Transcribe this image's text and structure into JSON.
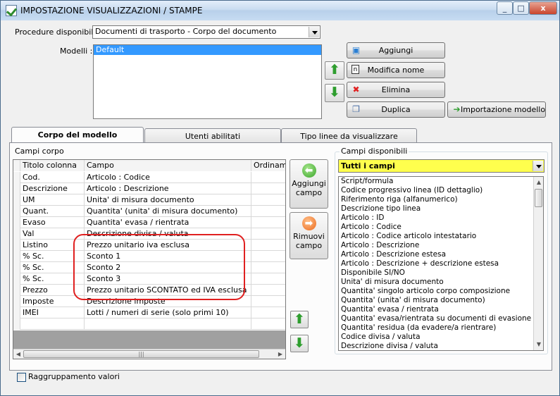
{
  "window": {
    "title": "IMPOSTAZIONE VISUALIZZAZIONI / STAMPE",
    "min_glyph": "_",
    "max_glyph": "□",
    "close_glyph": "x"
  },
  "top": {
    "procedure_label": "Procedure disponibili :",
    "procedure_value": "Documenti di trasporto - Corpo del documento",
    "models_label": "Modelli :",
    "models": [
      "Default"
    ],
    "buttons": {
      "add": "Aggiungi",
      "rename": "Modifica nome",
      "delete": "Elimina",
      "duplicate": "Duplica",
      "import": "Importazione modello"
    }
  },
  "tabs": [
    "Corpo del modello",
    "Utenti abilitati",
    "Tipo linee da visualizzare"
  ],
  "body": {
    "group_label": "Campi corpo",
    "columns": [
      "Titolo colonna",
      "Campo",
      "Ordinamen"
    ],
    "rows": [
      [
        "Cod.",
        "Articolo : Codice"
      ],
      [
        "Descrizione",
        "Articolo : Descrizione"
      ],
      [
        "UM",
        "Unita' di misura documento"
      ],
      [
        "Quant.",
        "Quantita' (unita' di misura documento)"
      ],
      [
        "Evaso",
        "Quantita' evasa / rientrata"
      ],
      [
        "Val",
        "Descrizione divisa / valuta"
      ],
      [
        "Listino",
        "Prezzo unitario iva esclusa"
      ],
      [
        "% Sc.",
        "Sconto 1"
      ],
      [
        "% Sc.",
        "Sconto 2"
      ],
      [
        "% Sc.",
        "Sconto 3"
      ],
      [
        "Prezzo",
        "Prezzo unitario SCONTATO ed IVA esclusa"
      ],
      [
        "Imposte",
        "Descrizione imposte"
      ],
      [
        "IMEI",
        "Lotti / numeri di serie (solo primi 10)"
      ]
    ],
    "add_field": "Aggiungi campo",
    "remove_field": "Rimuovi campo",
    "available_label": "Campi disponibili",
    "filter_value": "Tutti i campi",
    "available_fields": [
      "Script/formula",
      "Codice progressivo linea (ID dettaglio)",
      "Riferimento riga (alfanumerico)",
      "Descrizione tipo linea",
      "Articolo : ID",
      "Articolo : Codice",
      "Articolo : Codice articolo intestatario",
      "Articolo : Descrizione",
      "Articolo : Descrizione estesa",
      "Articolo : Descrizione + descrizione estesa",
      "Disponibile SI/NO",
      "Unita' di misura documento",
      "Quantita' singolo articolo corpo composizione",
      "Quantita' (unita' di misura documento)",
      "Quantita' evasa / rientrata",
      "Quantita' evasa/rientrata su documenti di evasione colleg",
      "Quantita' residua (da evadere/a rientrare)",
      "Codice divisa / valuta",
      "Descrizione divisa / valuta"
    ],
    "grouping_label": "Raggruppamento valori"
  },
  "colors": {
    "filter_bg": "#ffff4d",
    "selection": "#3399ff",
    "highlight_circle": "#e02020"
  }
}
